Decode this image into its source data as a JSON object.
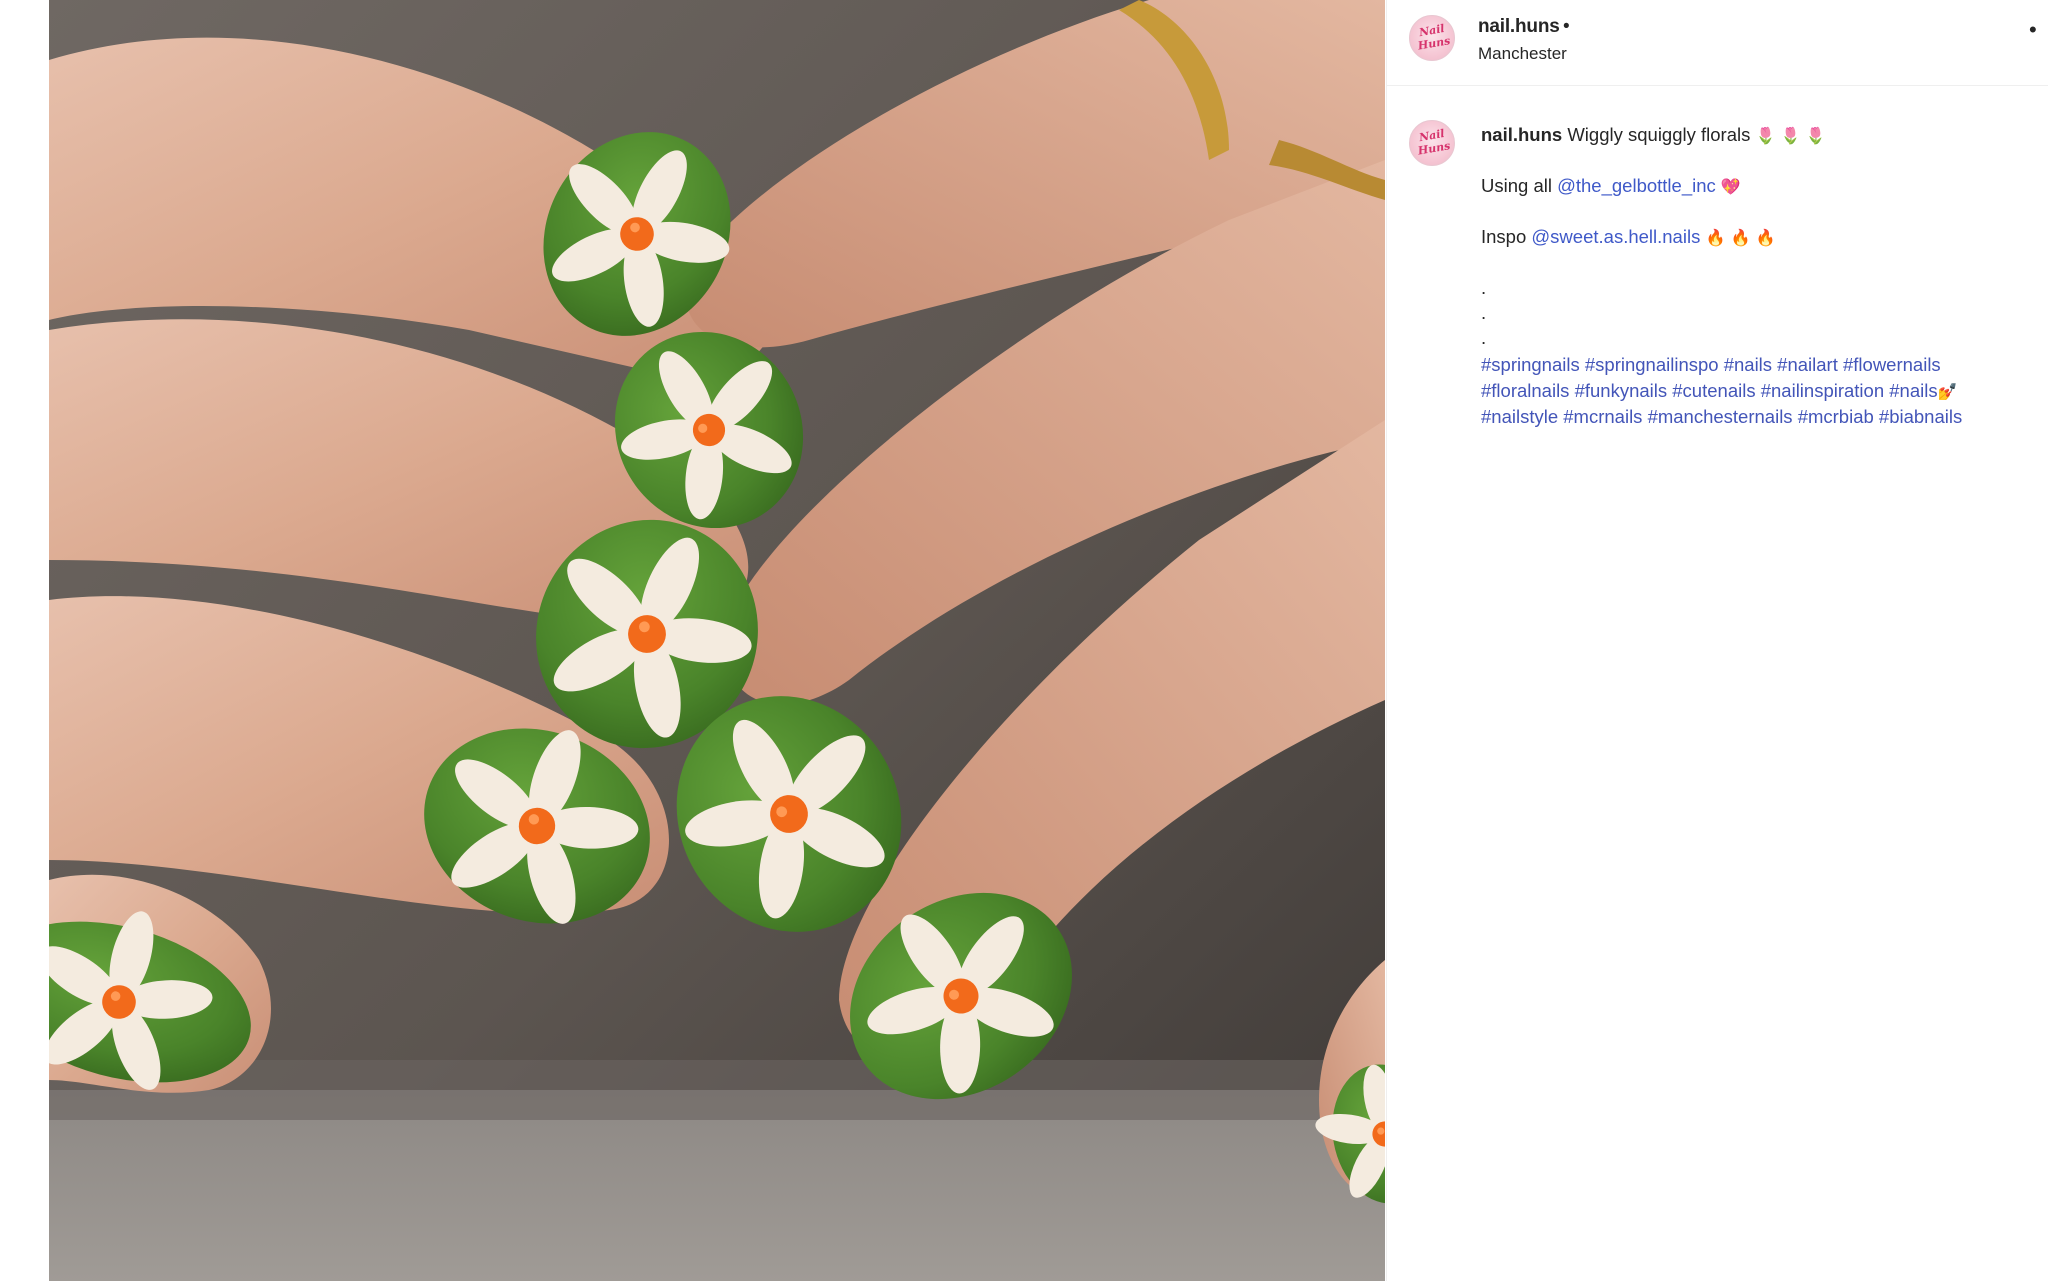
{
  "post": {
    "username": "nail.huns",
    "header_separator": "•",
    "location": "Manchester",
    "more_icon": "more-options-icon",
    "avatar_logo_text": "Nail Huns"
  },
  "caption": {
    "author": "nail.huns",
    "line1_text": " Wiggly squiggly florals ",
    "line1_emoji": "🌷 🌷 🌷",
    "line2_text": "Using all ",
    "line2_mention": "@the_gelbottle_inc",
    "line2_emoji": "💖",
    "line3_text": "Inspo ",
    "line3_mention": "@sweet.as.hell.nails",
    "line3_emoji": "🔥 🔥 🔥",
    "dots": [
      ".",
      ".",
      "."
    ],
    "hashtag_line1": "#springnails #springnailinspo #nails #nailart #flowernails",
    "hashtag_line2": "#floralnails #funkynails #cutenails #nailinspiration #nails",
    "hashtag_line2_emoji": "💅",
    "hashtag_line3": "#nailstyle #mcrnails #manchesternails #mcrbiab #biabnails"
  },
  "colors": {
    "link": "#3f59c8",
    "nail_green": "#4e8a2c",
    "petal_cream": "#f4ebdf",
    "center_orange": "#f26a1b"
  }
}
